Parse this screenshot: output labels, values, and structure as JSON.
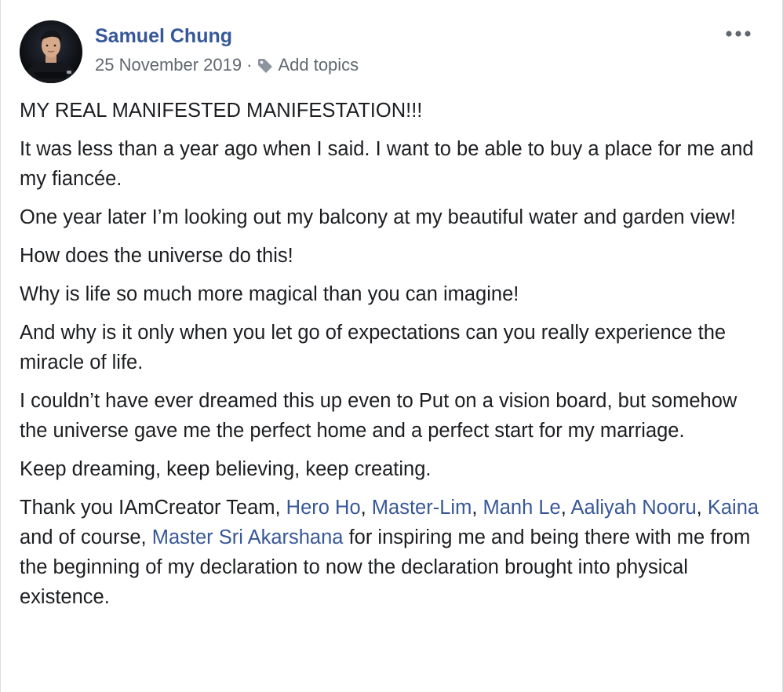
{
  "post": {
    "author": "Samuel Chung",
    "date": "25 November 2019",
    "separator": "·",
    "add_topics": "Add topics",
    "paragraphs": [
      "MY REAL MANIFESTED MANIFESTATION!!!",
      "It was less than a year ago when I said. I want to be able to buy a place for me and my fiancée.",
      "One year later I’m looking out my balcony at my beautiful water and garden view!",
      "How does the universe do this!",
      "Why is life so much more magical than you can imagine!",
      "And why is it only when you let go of expectations can you really experience the miracle of life.",
      "I couldn’t have ever dreamed this up even to Put on a vision board, but somehow the universe gave me the perfect home and a perfect start for my marriage.",
      "Keep dreaming, keep believing, keep creating."
    ],
    "thanks": {
      "intro": "Thank you IAmCreator Team, ",
      "tag1": "Hero Ho",
      "sep1": ", ",
      "tag2": "Master-Lim",
      "sep2": ", ",
      "tag3": "Manh Le",
      "sep3": ", ",
      "tag4": "Aaliyah Nooru",
      "sep4": ", ",
      "tag5": "Kaina",
      "mid": " and of course, ",
      "tag6": "Master Sri Akarshana",
      "outro": " for inspiring me and being there with me from the beginning of my declaration to now the declaration brought into physical existence."
    }
  },
  "icons": {
    "tag": "tag-icon",
    "more": "more-horizontal-icon"
  },
  "colors": {
    "author_link": "#365899",
    "tag_link": "#385898",
    "meta_text": "#616770",
    "body_text": "#1c1e21"
  }
}
